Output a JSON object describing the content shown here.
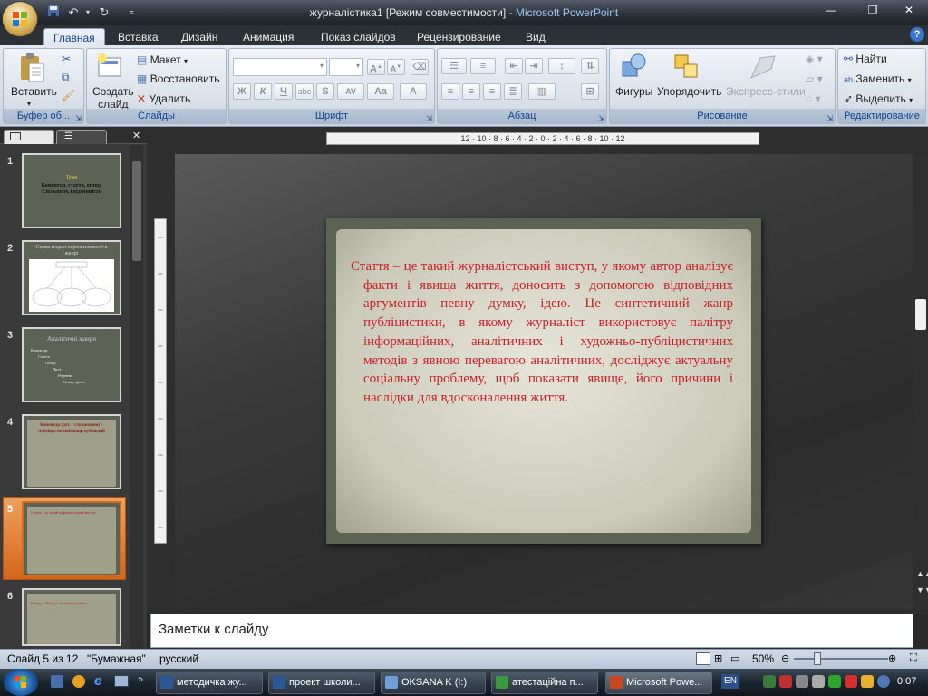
{
  "window": {
    "title_doc": "журналістика1 [Режим совместимости]",
    "title_sep": " - ",
    "title_app": "Microsoft PowerPoint"
  },
  "tabs": [
    "Главная",
    "Вставка",
    "Дизайн",
    "Анимация",
    "Показ слайдов",
    "Рецензирование",
    "Вид"
  ],
  "ribbon": {
    "clipboard": {
      "label": "Буфер об...",
      "paste": "Вставить"
    },
    "slides": {
      "label": "Слайды",
      "new_slide_1": "Создать",
      "new_slide_2": "слайд",
      "layout": "Макет",
      "reset": "Восстановить",
      "delete": "Удалить"
    },
    "font": {
      "label": "Шрифт",
      "bold": "Ж",
      "italic": "К",
      "underline": "Ч",
      "strike": "abc",
      "shadow": "S",
      "spacing": "AV",
      "case": "Aa",
      "color": "A",
      "grow": "A",
      "shrink": "A"
    },
    "paragraph": {
      "label": "Абзац"
    },
    "drawing": {
      "label": "Рисование",
      "shapes": "Фигуры",
      "arrange": "Упорядочить",
      "quick_styles": "Экспресс-стили"
    },
    "editing": {
      "label": "Редактирование",
      "find": "Найти",
      "replace": "Заменить",
      "select": "Выделить"
    }
  },
  "thumbnails": [
    {
      "num": "1",
      "title": "Тема",
      "body": "Коментар, стаття, огляд. Спільність і відмінність"
    },
    {
      "num": "2",
      "title": "Схема подачі переконливості в жанрі"
    },
    {
      "num": "3",
      "title": "Аналітичні жанри",
      "items": [
        "Коментар",
        "Стаття",
        "Огляд",
        "Лист",
        "Рецензія",
        "Огляд преси"
      ]
    },
    {
      "num": "4",
      "body": "Коментар (лат. - тлумачення) – публіцистичний жанр публікації"
    },
    {
      "num": "5",
      "body": "Стаття – це такий журналістський виступ"
    },
    {
      "num": "6",
      "body": "Огляд – Огляд є загальна оцінка"
    }
  ],
  "slide": {
    "body": "Стаття – це такий журналістський виступ, у якому автор аналізує факти і явища життя, доносить з допомогою відповідних аргументів певну думку, ідею. Це синтетичний жанр публіцистики, в якому журналіст використовує палітру інформаційних, аналітичних і художньо-публіцистичних методів з явною перевагою аналітичних, досліджує актуальну соціальну проблему, щоб показати явище, його причини і наслідки для вдосконалення життя."
  },
  "notes_placeholder": "Заметки к слайду",
  "statusbar": {
    "slide_info": "Слайд 5 из 12",
    "theme": "\"Бумажная\"",
    "language": "русский",
    "zoom": "50%"
  },
  "ruler": {
    "horizontal": "12 · 10 · 8 · 6 · 4 · 2 · 0 · 2 · 4 · 6 · 8 · 10 · 12"
  },
  "taskbar": {
    "items": [
      "методичка жу...",
      "проект школи...",
      "OKSANA K (I:)",
      "атестаційна п...",
      "Microsoft Powe..."
    ],
    "lang": "EN",
    "clock": "0:07"
  },
  "colors": {
    "slide_text": "#c8212b",
    "ribbon_label": "#15428b",
    "selected_thumb": "#d4661b"
  }
}
